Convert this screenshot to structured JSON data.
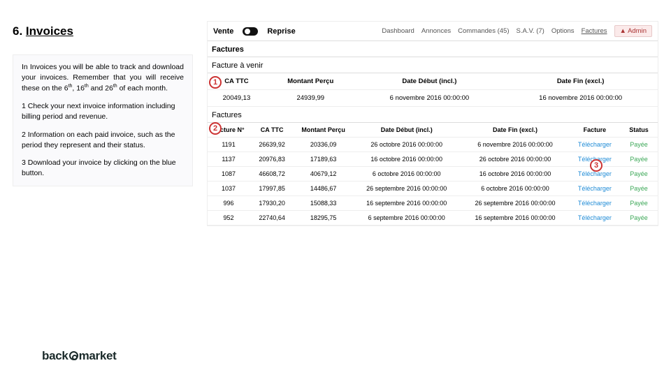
{
  "title": {
    "num": "6.",
    "text": "Invoices"
  },
  "desc": {
    "intro_a": "In Invoices you will be able to track and download your invoices. Remember that you will receive these on the 6",
    "intro_b": ", 16",
    "intro_c": " and 26",
    "intro_d": " of each month.",
    "sup": "th",
    "p1": "1 Check your next invoice information including billing period and revenue.",
    "p2": "2 Information on each paid invoice, such as the period they represent and their status.",
    "p3": "3 Download your invoice by clicking on the blue button."
  },
  "nav": {
    "vente": "Vente",
    "reprise": "Reprise",
    "links": [
      "Dashboard",
      "Annonces",
      "Commandes (45)",
      "S.A.V. (7)",
      "Options",
      "Factures"
    ],
    "admin": "Admin"
  },
  "sections": {
    "upcoming": "Facture à venir",
    "invoices": "Factures"
  },
  "upcoming": {
    "head": [
      "CA TTC",
      "Montant Perçu",
      "Date Début (incl.)",
      "Date Fin (excl.)"
    ],
    "row": [
      "20049,13",
      "24939,99",
      "6 novembre 2016 00:00:00",
      "16 novembre 2016 00:00:00"
    ]
  },
  "invHead": [
    "Facture N°",
    "CA TTC",
    "Montant Perçu",
    "Date Début (incl.)",
    "Date Fin (excl.)",
    "Facture",
    "Status"
  ],
  "invRows": [
    {
      "n": "1191",
      "ca": "26639,92",
      "mp": "20336,09",
      "dd": "26 octobre 2016 00:00:00",
      "df": "6 novembre 2016 00:00:00",
      "dl": "Télécharger",
      "st": "Payée"
    },
    {
      "n": "1137",
      "ca": "20976,83",
      "mp": "17189,63",
      "dd": "16 octobre 2016 00:00:00",
      "df": "26 octobre 2016 00:00:00",
      "dl": "Télécharger",
      "st": "Payée"
    },
    {
      "n": "1087",
      "ca": "46608,72",
      "mp": "40679,12",
      "dd": "6 octobre 2016 00:00:00",
      "df": "16 octobre 2016 00:00:00",
      "dl": "Télécharger",
      "st": "Payée"
    },
    {
      "n": "1037",
      "ca": "17997,85",
      "mp": "14486,67",
      "dd": "26 septembre 2016 00:00:00",
      "df": "6 octobre 2016 00:00:00",
      "dl": "Télécharger",
      "st": "Payée"
    },
    {
      "n": "996",
      "ca": "17930,20",
      "mp": "15088,33",
      "dd": "16 septembre 2016 00:00:00",
      "df": "26 septembre 2016 00:00:00",
      "dl": "Télécharger",
      "st": "Payée"
    },
    {
      "n": "952",
      "ca": "22740,64",
      "mp": "18295,75",
      "dd": "6 septembre 2016 00:00:00",
      "df": "16 septembre 2016 00:00:00",
      "dl": "Télécharger",
      "st": "Payée"
    }
  ],
  "callouts": {
    "c1": "1",
    "c2": "2",
    "c3": "3"
  },
  "logo": {
    "a": "back",
    "b": "market"
  }
}
